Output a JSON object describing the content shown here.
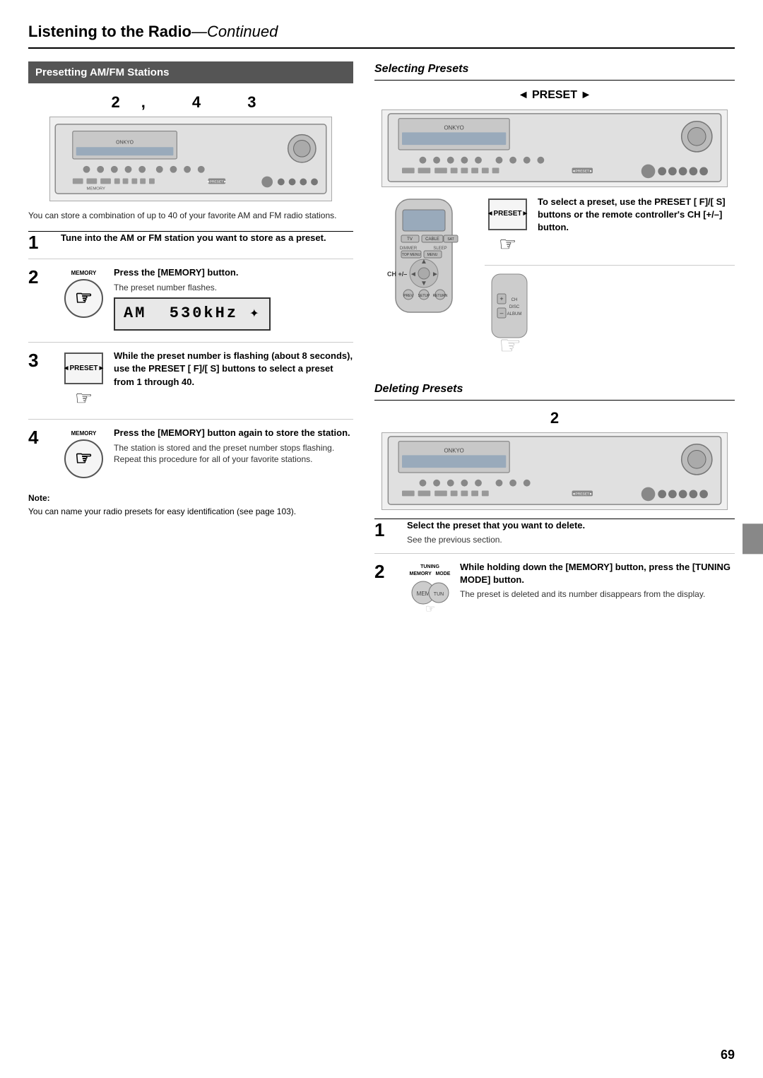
{
  "page": {
    "title": "Listening to the Radio",
    "title_continued": "—Continued",
    "page_number": "69"
  },
  "left_section": {
    "header": "Presetting AM/FM Stations",
    "step_numbers_above": "2, 4    3",
    "intro": "You can store a combination of up to 40 of your favorite AM and FM radio stations.",
    "steps": [
      {
        "number": "1",
        "bold": "Tune into the AM or FM station you want to store as a preset.",
        "text": ""
      },
      {
        "number": "2",
        "bold": "Press the [MEMORY] button.",
        "text": "The preset number flashes.",
        "display": "AM   530kHz  ✦"
      },
      {
        "number": "3",
        "bold": "While the preset number is flashing (about 8 seconds), use the PRESET [ F]/[ S] buttons to select a preset from 1 through 40.",
        "text": ""
      },
      {
        "number": "4",
        "bold": "Press the [MEMORY] button again to store the station.",
        "text_lines": [
          "The station is stored and the preset number stops flashing.",
          "Repeat this procedure for all of your favorite stations."
        ]
      }
    ],
    "note_label": "Note:",
    "note_text": "You can name your radio presets for easy identification (see page 103)."
  },
  "right_section": {
    "selecting_presets": {
      "title": "Selecting Presets",
      "preset_label": "◄ PRESET ►",
      "ch_label": "CH +/–",
      "step_text": "To select a preset, use the PRESET [ F]/[ S] buttons or the remote controller's CH [+/–] button."
    },
    "deleting_presets": {
      "title": "Deleting Presets",
      "step_number_above": "2",
      "steps": [
        {
          "number": "1",
          "bold": "Select the preset that you want to delete.",
          "text": "See the previous section."
        },
        {
          "number": "2",
          "bold": "While holding down the [MEMORY] button, press the [TUNING MODE] button.",
          "text": "The preset is deleted and its number disappears from the display."
        }
      ]
    }
  }
}
